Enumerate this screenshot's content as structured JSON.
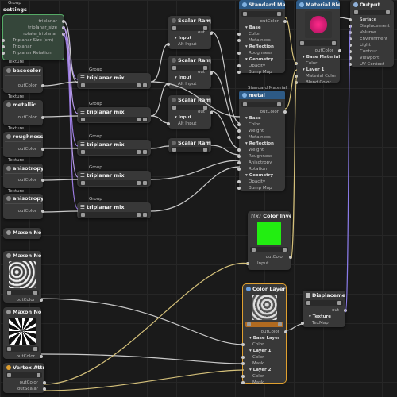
{
  "nodes": {
    "group_settings": {
      "caption": "Group",
      "title": "settings",
      "ports": [
        "triplanar",
        "triplanar_size",
        "rotate_triplanar",
        "Triplanar Size (cm)",
        "Triplanar",
        "Triplanar Rotation"
      ]
    },
    "tex_basecolor": {
      "caption": "Texture",
      "title": "basecolor",
      "out": "outColor"
    },
    "tex_metallic": {
      "caption": "Texture",
      "title": "metallic",
      "out": "outColor"
    },
    "tex_roughness": {
      "caption": "Texture",
      "title": "roughness",
      "out": "outColor"
    },
    "tex_aniso_level": {
      "caption": "Texture",
      "title": "anisotropyLevel",
      "out": "outColor"
    },
    "tex_aniso_angle": {
      "caption": "Texture",
      "title": "anisotropyAngle",
      "out": "outColor"
    },
    "triplanar_1": {
      "caption": "Group",
      "title": "triplanar mix"
    },
    "triplanar_2": {
      "caption": "Group",
      "title": "triplanar mix"
    },
    "triplanar_3": {
      "caption": "Group",
      "title": "triplanar mix"
    },
    "triplanar_4": {
      "caption": "Group",
      "title": "triplanar mix"
    },
    "triplanar_5": {
      "caption": "Group",
      "title": "triplanar mix"
    },
    "scalar_ramp_1": {
      "title": "Scalar Ramp",
      "out": "out",
      "section": "Input",
      "port": "Alt Input"
    },
    "scalar_ramp_2": {
      "title": "Scalar Ramp",
      "out": "out",
      "section": "Input",
      "port": "Alt Input"
    },
    "scalar_ramp_3": {
      "title": "Scalar Ramp",
      "out": "out",
      "section": "Input",
      "port": "Alt Input"
    },
    "scalar_ramp_4": {
      "title": "Scalar Ramp"
    },
    "std_mat_1": {
      "title": "Standard Material",
      "out": "outColor",
      "rows": [
        "Base",
        "Color",
        "Metalness",
        "Reflection",
        "Roughness",
        "Geometry",
        "Opacity",
        "Bump Map"
      ]
    },
    "std_mat_2": {
      "caption": "Standard Material",
      "title": "metal",
      "out": "outColor",
      "rows": [
        "Base",
        "Color",
        "Weight",
        "Metalness",
        "Reflection",
        "Weight",
        "Roughness",
        "Anisotropy",
        "Rotation",
        "Geometry",
        "Opacity",
        "Bump Map"
      ]
    },
    "material_blender": {
      "title": "Material Blender",
      "out": "outColor",
      "rows": [
        "Base Material",
        "Color",
        "Layer 1",
        "Material Color",
        "Blend Color"
      ]
    },
    "output": {
      "title": "Output",
      "rows": [
        "Surface",
        "Displacement",
        "Volume",
        "Environment",
        "Light",
        "Contour",
        "Viewport",
        "UV Context"
      ]
    },
    "color_invert": {
      "title": "Color Invert",
      "prefix": "f(x)",
      "out": "outColor",
      "in": "Input",
      "swatch": "#22ee11"
    },
    "maxon_noise_1": {
      "title": "Maxon Noise"
    },
    "maxon_noise_2": {
      "title": "Maxon Noise",
      "out": "outColor"
    },
    "maxon_noise_3": {
      "title": "Maxon Noise",
      "out": "outColor"
    },
    "vertex_attr": {
      "title": "Vertex Attribute",
      "outs": [
        "outColor",
        "outScalar"
      ]
    },
    "color_layer": {
      "title": "Color Layer",
      "out": "outColor",
      "rows": [
        "Base Layer",
        "Color",
        "Layer 1",
        "Color",
        "Mask",
        "Layer 2",
        "Color",
        "Mask"
      ]
    },
    "displacement": {
      "title": "Displacement",
      "out": "out",
      "section": "Texture",
      "port": "TexMap"
    }
  },
  "icons": {
    "menu": "hamburger-icon",
    "image": "image-icon",
    "folder": "folder-icon"
  },
  "colors": {
    "wire": "#c9c9c9",
    "wire_triplanar": "#9a7ae0",
    "wire_vertex": "#d4c07a",
    "wire_output": "#8a7be8",
    "accent_material": "#3f6f9f",
    "selected": "#e0a030"
  }
}
